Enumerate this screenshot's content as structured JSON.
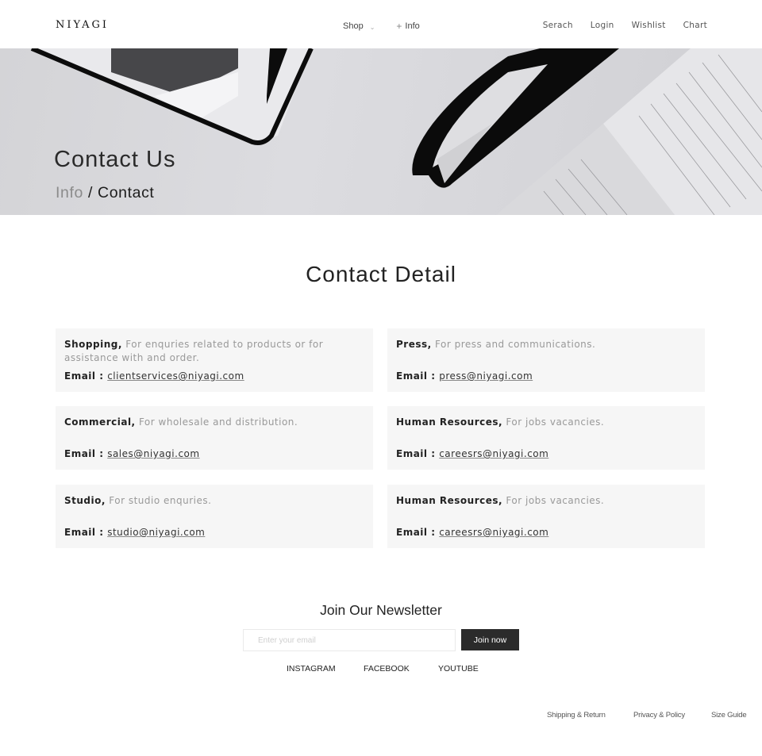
{
  "header": {
    "logo": "NIYAGI",
    "nav_center": [
      {
        "label": "Shop",
        "icon": "chevron-down-icon"
      },
      {
        "label": "Info",
        "icon": "plus-icon"
      }
    ],
    "nav_right": [
      "Serach",
      "Login",
      "Wishlist",
      "Chart"
    ]
  },
  "hero": {
    "title": "Contact Us",
    "breadcrumb": {
      "parent": "Info",
      "separator": "/",
      "current": "Contact"
    }
  },
  "contact": {
    "title": "Contact Detail",
    "email_label": "Email :",
    "cards": [
      {
        "name": "Shopping,",
        "description": "For enquries related to products or for assistance with and order.",
        "email": "clientservices@niyagi.com"
      },
      {
        "name": "Press,",
        "description": "For press and communications.",
        "email": "press@niyagi.com"
      },
      {
        "name": "Commercial,",
        "description": "For wholesale and distribution.",
        "email": "sales@niyagi.com"
      },
      {
        "name": "Human Resources,",
        "description": "For jobs vacancies.",
        "email": "careesrs@niyagi.com"
      },
      {
        "name": "Studio,",
        "description": "For studio enquries.",
        "email": "studio@niyagi.com"
      },
      {
        "name": "Human Resources,",
        "description": "For jobs vacancies.",
        "email": "careesrs@niyagi.com"
      }
    ]
  },
  "newsletter": {
    "title": "Join Our Newsletter",
    "input_value": "",
    "input_placeholder": "Enter your email",
    "button_label": "Join now",
    "social": [
      "INSTAGRAM",
      "FACEBOOK",
      "YOUTUBE"
    ]
  },
  "footer": {
    "links": [
      "Shipping & Return",
      "Privacy & Policy",
      "Size Guide"
    ]
  }
}
